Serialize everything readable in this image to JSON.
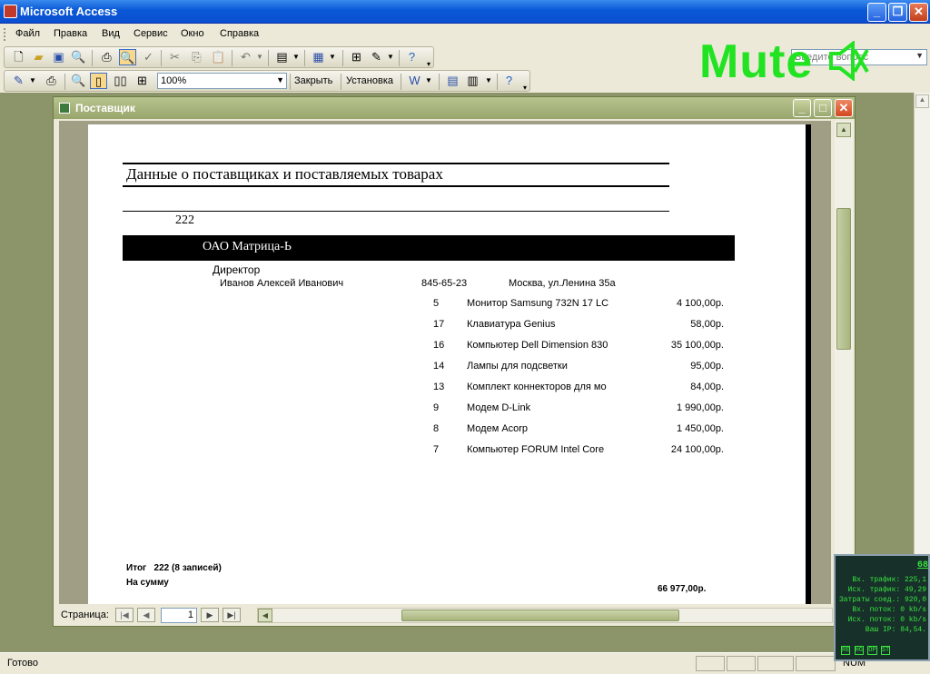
{
  "app": {
    "title": "Microsoft Access",
    "icon": "access-key-icon"
  },
  "menu": [
    "Файл",
    "Правка",
    "Вид",
    "Сервис",
    "Окно",
    "Справка"
  ],
  "help_box": {
    "placeholder": "Введите вопрос"
  },
  "overlay": {
    "mute_text": "Mute"
  },
  "toolbar2": {
    "zoom": "100%",
    "close_label": "Закрыть",
    "setup_label": "Установка"
  },
  "report_window": {
    "title": "Поставщик"
  },
  "report": {
    "title": "Данные о поставщиках и поставляемых товарах",
    "group_id": "222",
    "company": "ОАО Матрица-Ь",
    "position": "Директор",
    "contact_name": "Иванов Алексей Иванович",
    "phone": "845-65-23",
    "address": "Москва, ул.Ленина 35а",
    "items": [
      {
        "id": "5",
        "name": "Монитор Samsung 732N 17 LC",
        "price": "4 100,00р."
      },
      {
        "id": "17",
        "name": "Клавиатура Genius",
        "price": "58,00р."
      },
      {
        "id": "16",
        "name": "Компьютер Dell Dimension 830",
        "price": "35 100,00р."
      },
      {
        "id": "14",
        "name": "Лампы для подсветки",
        "price": "95,00р."
      },
      {
        "id": "13",
        "name": "Комплект коннекторов для мо",
        "price": "84,00р."
      },
      {
        "id": "9",
        "name": "Модем D-Link",
        "price": "1 990,00р."
      },
      {
        "id": "8",
        "name": "Модем Acorp",
        "price": "1 450,00р."
      },
      {
        "id": "7",
        "name": "Компьютер FORUM Intel Core",
        "price": "24 100,00р."
      }
    ],
    "total_line": "Итог   222 (8 записей)",
    "sum_label": "На сумму",
    "sum_value": "66 977,00р."
  },
  "nav": {
    "page_label": "Страница:",
    "page": "1"
  },
  "statusbar": {
    "text": "Готово",
    "num": "NUM"
  },
  "netmeter": {
    "value": "68",
    "rows": [
      {
        "label": "Вх. трафик:",
        "value": "225,1"
      },
      {
        "label": "Исх. трафик:",
        "value": "49,29"
      },
      {
        "label": "Затраты соед.:",
        "value": "920,0"
      },
      {
        "label": "Вх. поток:",
        "value": "0 kb/s"
      },
      {
        "label": "Исх. поток:",
        "value": "0 kb/s"
      },
      {
        "label": "Ваш IP:",
        "value": "84,54."
      }
    ],
    "buttons": [
      "RE",
      "HG",
      "OP",
      "ST"
    ]
  }
}
